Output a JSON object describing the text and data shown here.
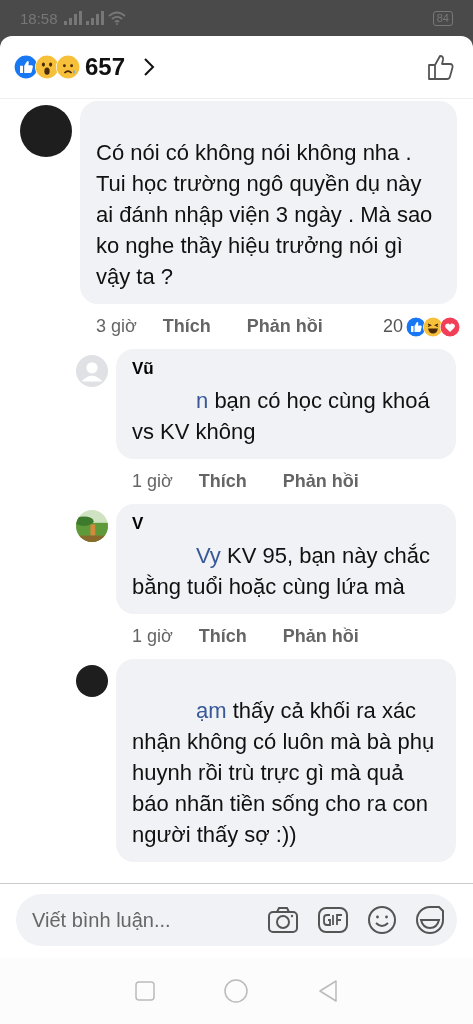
{
  "status_bar": {
    "time": "18:58",
    "battery": "84"
  },
  "header": {
    "reactions": [
      {
        "kind": "like"
      },
      {
        "kind": "wow"
      },
      {
        "kind": "sad"
      }
    ],
    "count": "657"
  },
  "comments": [
    {
      "kind": "top",
      "avatar": {
        "kind": "dark"
      },
      "text": "Có nói có không nói không nha . Tui học trường ngô quyền dụ này ai đánh nhập viện 3 ngày . Mà sao ko nghe thầy hiệu trưởng nói gì vậy ta ?",
      "time": "3 giờ",
      "like": "Thích",
      "reply": "Phản hồi",
      "reaction_count": "20",
      "reactions": [
        {
          "kind": "like"
        },
        {
          "kind": "haha"
        },
        {
          "kind": "love"
        }
      ]
    },
    {
      "kind": "reply",
      "avatar": {
        "kind": "default"
      },
      "name": "Vũ",
      "mention": "n",
      "text": "bạn có học cùng khoá vs KV không",
      "time": "1 giờ",
      "like": "Thích",
      "reply": "Phản hồi"
    },
    {
      "kind": "reply",
      "name": "V",
      "mention": "Vy",
      "text": "KV 95, bạn này chắc bằng tuổi hoặc cùng lứa mà",
      "time": "1 giờ",
      "like": "Thích",
      "reply": "Phản hồi"
    },
    {
      "kind": "reply",
      "avatar": {
        "kind": "dark"
      },
      "mention": "ạm",
      "text": "thấy cả khối ra xác nhận không có luôn mà bà phụ huynh rồi trù trực gì mà quả báo nhãn tiền sống cho ra con người thấy sợ :))"
    }
  ],
  "composer": {
    "placeholder": "Viết bình luận..."
  }
}
